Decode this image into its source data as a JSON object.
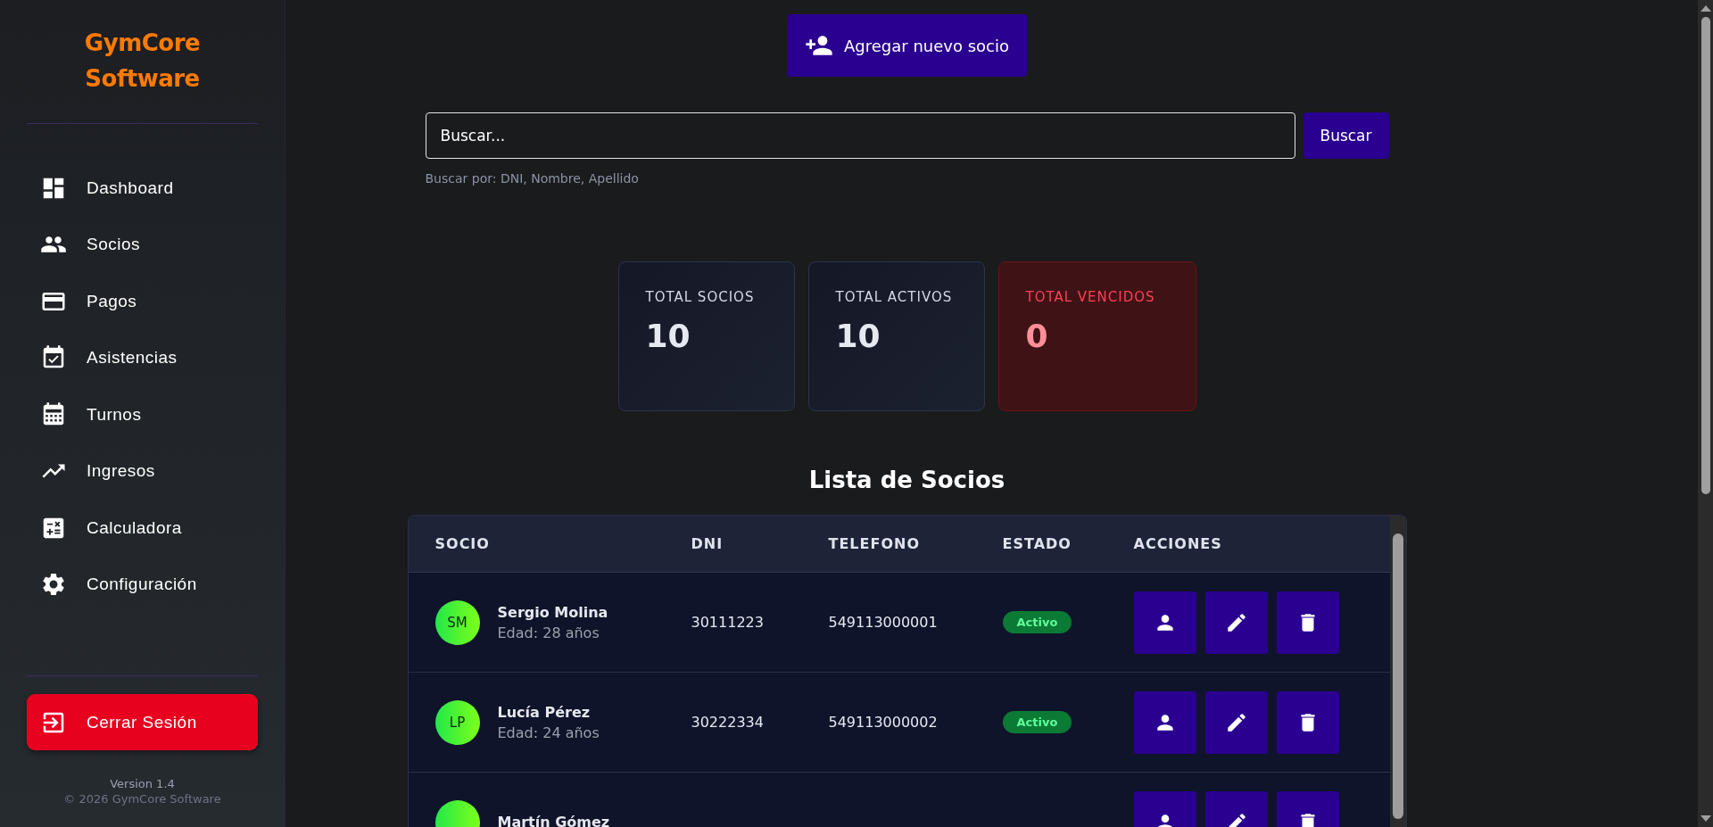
{
  "sidebar": {
    "brand": [
      "GymCore",
      "Software"
    ],
    "items": [
      {
        "label": "Dashboard",
        "selected": false
      },
      {
        "label": "Socios",
        "selected": false
      },
      {
        "label": "Pagos",
        "selected": false
      },
      {
        "label": "Asistencias",
        "selected": false
      },
      {
        "label": "Turnos",
        "selected": false
      },
      {
        "label": "Ingresos",
        "selected": false
      },
      {
        "label": "Calculadora",
        "selected": false
      },
      {
        "label": "Configuración",
        "selected": false
      }
    ],
    "logout": "Cerrar Sesión",
    "version": "Version 1.4",
    "copyright": "© 2026 GymCore Software"
  },
  "add_button": "Agregar nuevo socio",
  "search": {
    "placeholder": "Buscar...",
    "button": "Buscar",
    "hint": "Buscar por: DNI, Nombre, Apellido"
  },
  "stats": [
    {
      "label": "TOTAL SOCIOS",
      "value": "10",
      "kind": "normal"
    },
    {
      "label": "TOTAL ACTIVOS",
      "value": "10",
      "kind": "normal"
    },
    {
      "label": "TOTAL VENCIDOS",
      "value": "0",
      "kind": "danger"
    }
  ],
  "table": {
    "title": "Lista de Socios",
    "columns": [
      "SOCIO",
      "DNI",
      "TELEFONO",
      "ESTADO",
      "ACCIONES"
    ],
    "rows": [
      {
        "initials": "SM",
        "name": "Sergio Molina",
        "age": "Edad: 28 años",
        "dni": "30111223",
        "phone": "549113000001",
        "status": "Activo"
      },
      {
        "initials": "LP",
        "name": "Lucía Pérez",
        "age": "Edad: 24 años",
        "dni": "30222334",
        "phone": "549113000002",
        "status": "Activo"
      },
      {
        "name": "Martín Gómez"
      }
    ]
  }
}
